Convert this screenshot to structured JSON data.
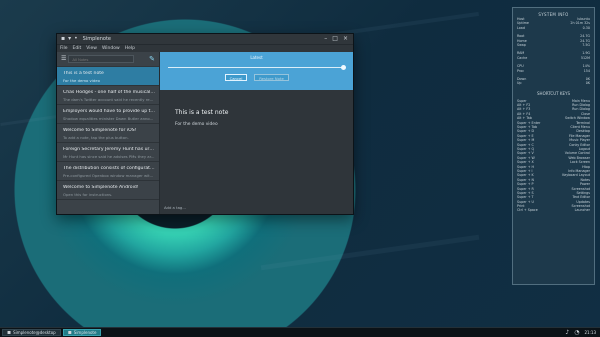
{
  "window": {
    "title": "Simplenote",
    "menu": [
      "File",
      "Edit",
      "View",
      "Window",
      "Help"
    ],
    "search_placeholder": "All Notes"
  },
  "notes": [
    {
      "title": "This is a test note",
      "preview": "For the demo video"
    },
    {
      "title": "Chas Hodges - one half of the musical d...",
      "preview": "The dam's Twitter account said he recently rec..."
    },
    {
      "title": "Employers would have to provide up to t...",
      "preview": "Shadow equalities minister Dawn Butler anno..."
    },
    {
      "title": "Welcome to Simplenote for iOS!",
      "preview": "To add a note, tap the plus button."
    },
    {
      "title": "Foreign Secretary Jeremy Hunt has urge...",
      "preview": "Mr Hunt has since said he advises PMs they ar..."
    },
    {
      "title": "The distribution consists of configuration...",
      "preview": "Pre-configured Openbox window manager wit..."
    },
    {
      "title": "Welcome to Simplenote Android!",
      "preview": "Open this for instructions."
    }
  ],
  "history": {
    "label": "Latest",
    "cancel": "Cancel",
    "restore": "Restore Note",
    "slider_value": 1.0
  },
  "editor": {
    "title": "This is a test note",
    "body": "For the demo video",
    "tag_placeholder": "Add a tag..."
  },
  "system_info": {
    "title": "SYSTEM INFO",
    "rows": [
      [
        "Host",
        "lubuntu"
      ],
      [
        "Uptime",
        "2h 01m 32s"
      ],
      [
        "Load",
        "0.30"
      ],
      [
        "",
        ""
      ],
      [
        "Root",
        "24.7G"
      ],
      [
        "Home",
        "24.7G"
      ],
      [
        "Swap",
        "7.5G"
      ],
      [
        "",
        ""
      ],
      [
        "RAM",
        "1.9G"
      ],
      [
        "Cache",
        "512M"
      ],
      [
        "",
        ""
      ],
      [
        "CPU",
        "14%"
      ],
      [
        "Proc",
        "154"
      ],
      [
        "",
        ""
      ],
      [
        "Down",
        "0K"
      ],
      [
        "Up",
        "0K"
      ]
    ]
  },
  "shortcuts": {
    "title": "SHORTCUT KEYS",
    "rows": [
      [
        "Super",
        "Main Menu"
      ],
      [
        "Alt + F2",
        "Run Dialog"
      ],
      [
        "Alt + F3",
        "Run Dialog"
      ],
      [
        "Alt + F4",
        "Close"
      ],
      [
        "Alt + Tab",
        "Switch Window"
      ],
      [
        "Super + Enter",
        "Terminal"
      ],
      [
        "Super + Tab",
        "Client Menu"
      ],
      [
        "Super + D",
        "Desktop"
      ],
      [
        "Super + E",
        "File Manager"
      ],
      [
        "Super + M",
        "Music Player"
      ],
      [
        "Super + C",
        "Conky Editor"
      ],
      [
        "Super + Q",
        "Logout"
      ],
      [
        "Super + V",
        "Volume Control"
      ],
      [
        "Super + W",
        "Web Browser"
      ],
      [
        "Super + X",
        "Lock Screen"
      ],
      [
        "Super + H",
        "Htop"
      ],
      [
        "Super + I",
        "Info Manager"
      ],
      [
        "Super + K",
        "Keyboard Layout"
      ],
      [
        "Super + N",
        "Notes"
      ],
      [
        "Super + P",
        "Power"
      ],
      [
        "Super + R",
        "Screenshot"
      ],
      [
        "Super + S",
        "Settings"
      ],
      [
        "Super + T",
        "Text Editor"
      ],
      [
        "Super + U",
        "Updates"
      ],
      [
        "Print",
        "Screenshot"
      ],
      [
        "Ctrl + Space",
        "Launcher"
      ]
    ]
  },
  "taskbar": {
    "items": [
      "Simplenote@desktop",
      "Simplenote"
    ],
    "clock": "21:13"
  }
}
